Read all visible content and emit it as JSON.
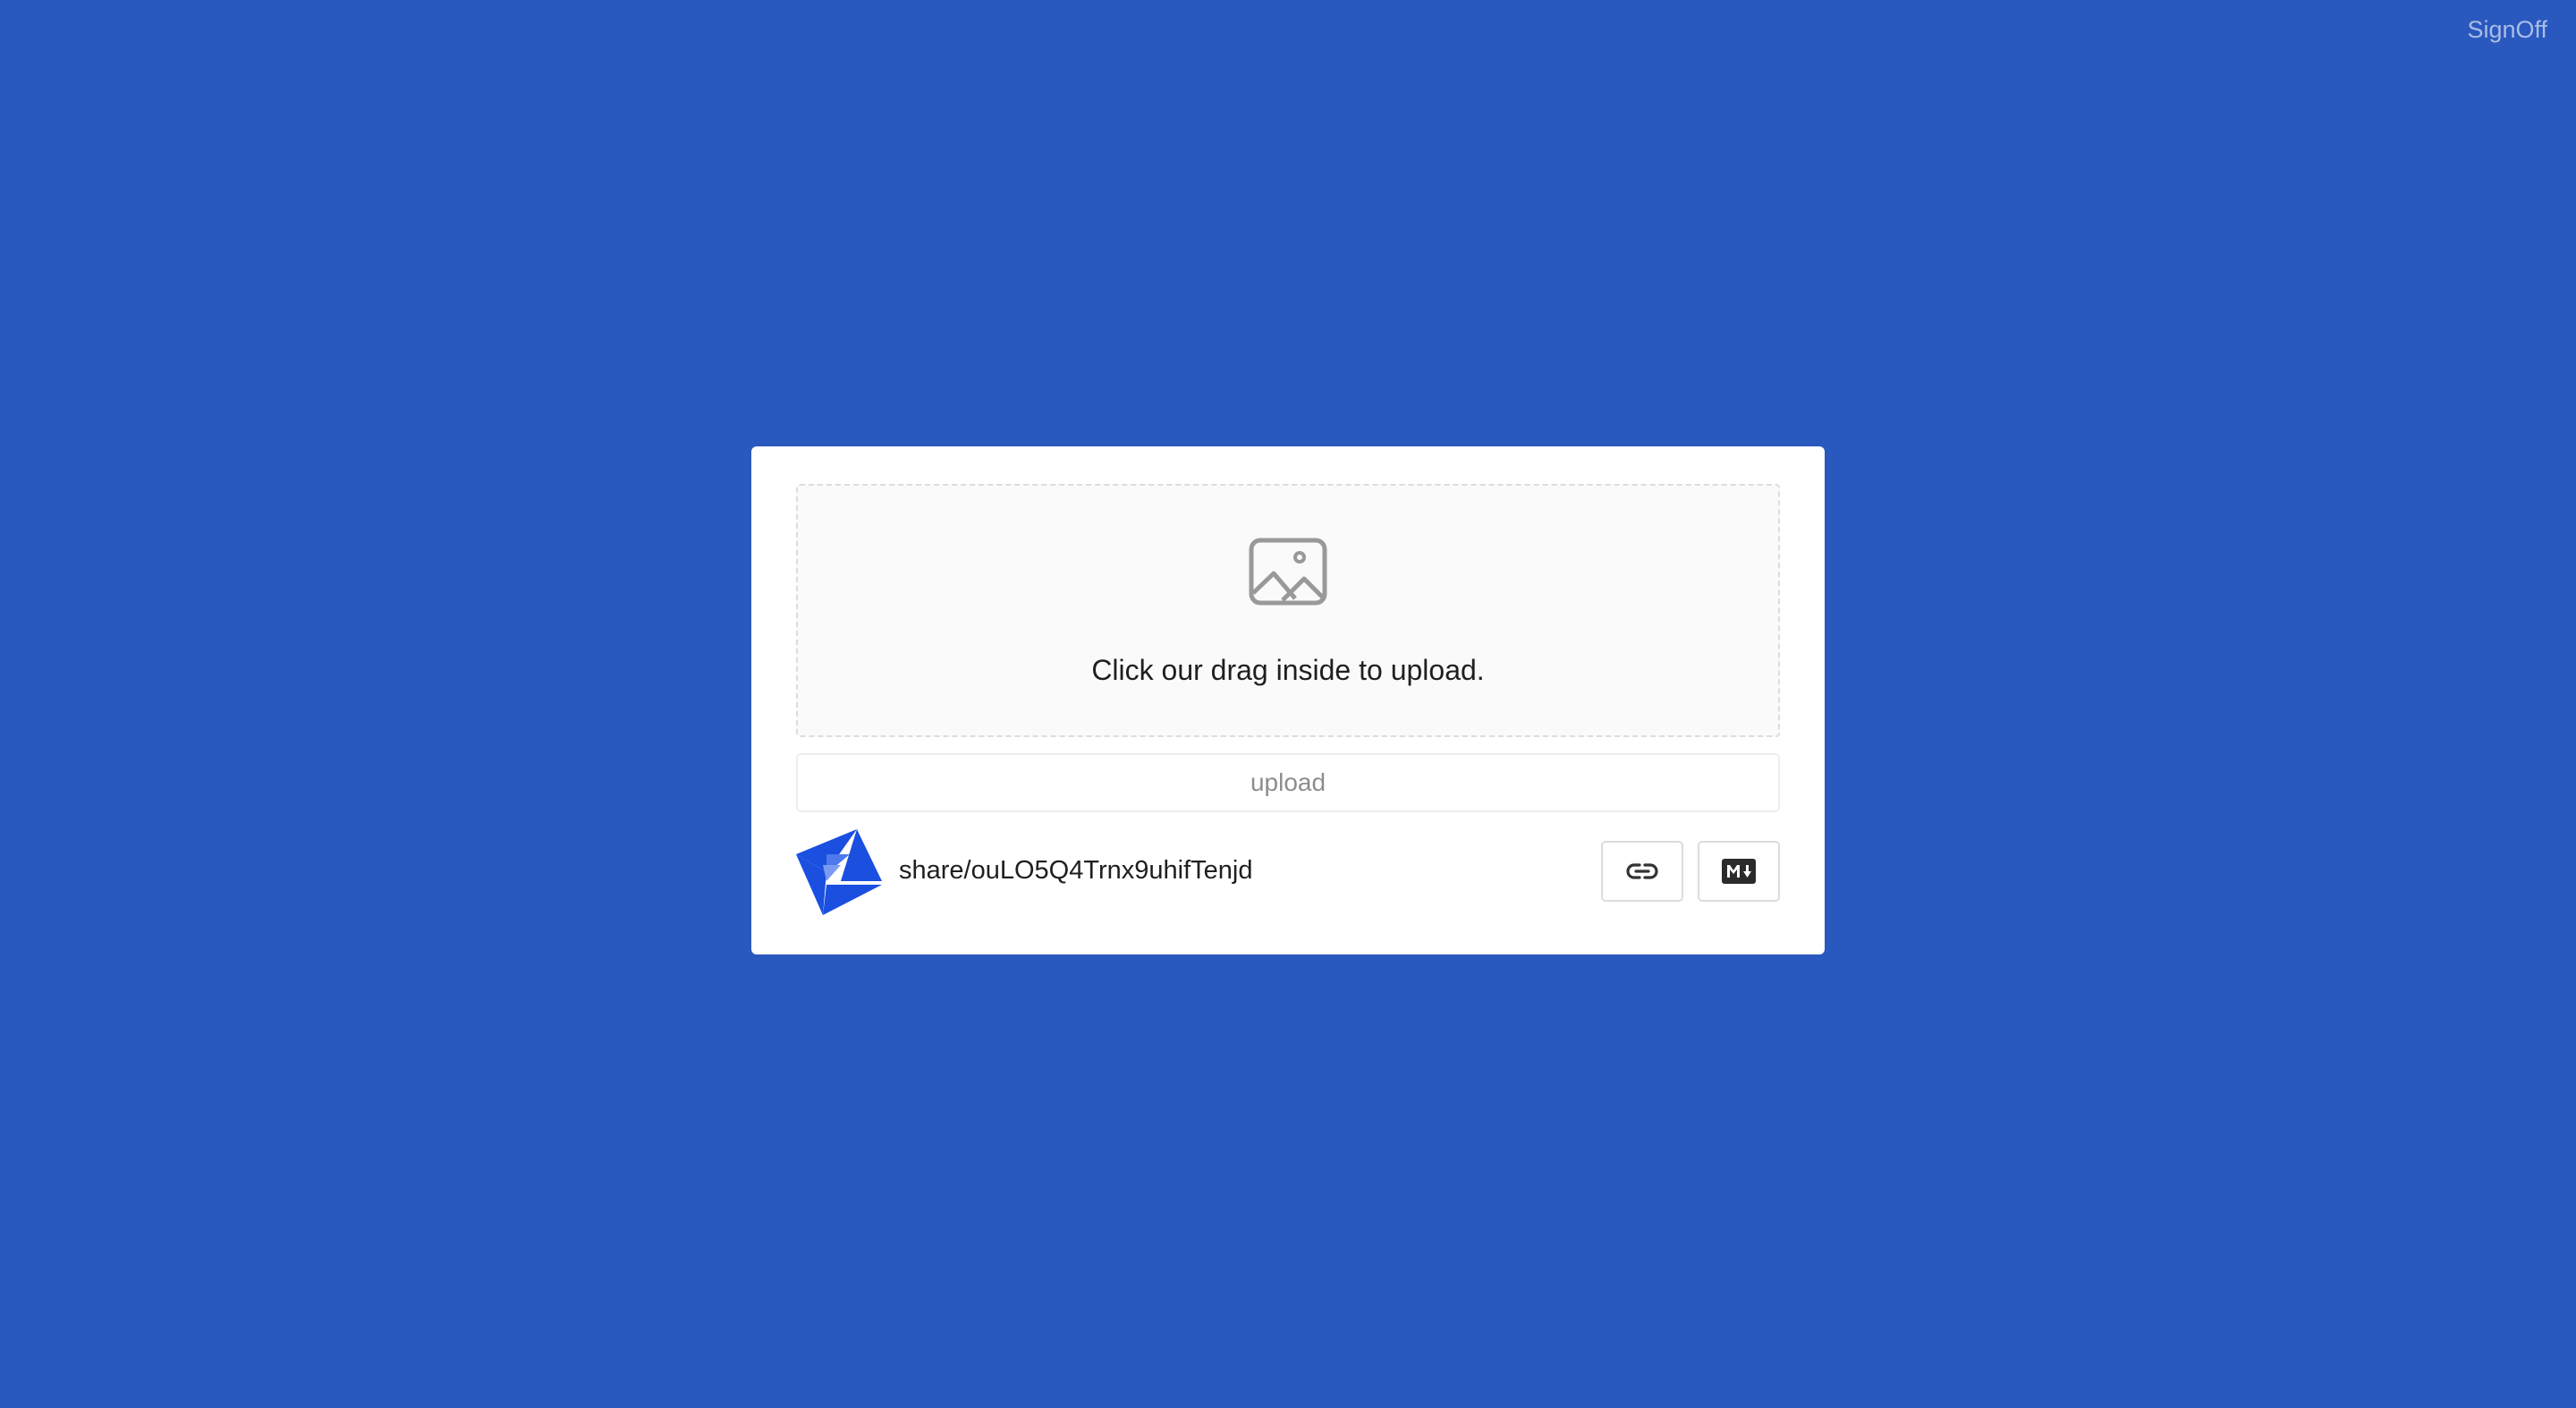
{
  "header": {
    "signoff_label": "SignOff"
  },
  "uploader": {
    "hint": "Click our drag inside to upload.",
    "upload_label": "upload",
    "icon": "image-icon"
  },
  "result": {
    "path": "share/ouLO5Q4Trnx9uhifTenjd",
    "copy_link_icon": "link-icon",
    "copy_markdown_icon": "markdown-icon"
  },
  "colors": {
    "background": "#2958be",
    "card": "#ffffff",
    "dropzone_bg": "#fafafb",
    "thumb_blue": "#1a4fe0"
  }
}
